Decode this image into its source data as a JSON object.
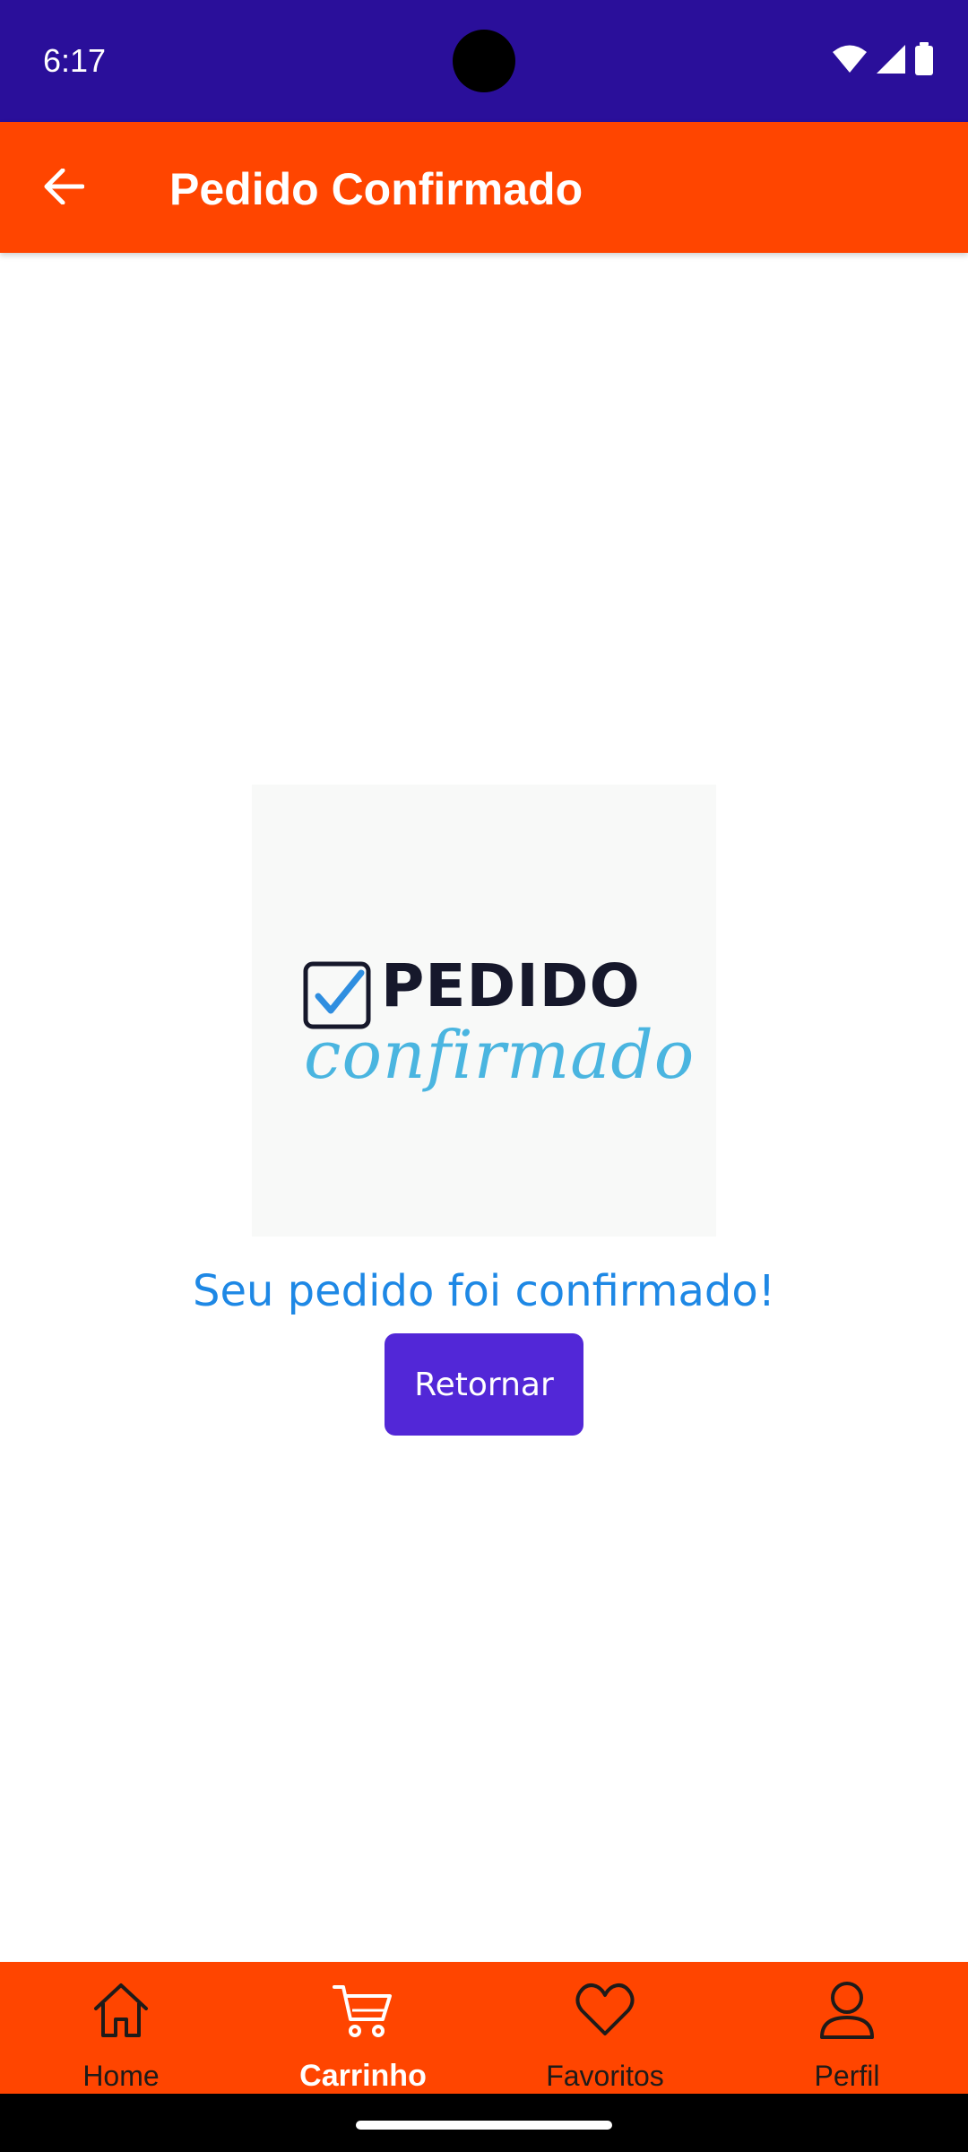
{
  "status_bar": {
    "time": "6:17"
  },
  "app_bar": {
    "title": "Pedido Confirmado",
    "back_icon": "arrow-back-icon"
  },
  "confirmation_image": {
    "title_word": "PEDIDO",
    "script_word": "confirmado",
    "check_icon": "checkbox-check-icon"
  },
  "message": "Seu pedido foi confirmado!",
  "return_button": {
    "label": "Retornar"
  },
  "bottom_nav": {
    "active": "Carrinho",
    "items": [
      {
        "label": "Home",
        "icon": "home-icon"
      },
      {
        "label": "Carrinho",
        "icon": "cart-icon"
      },
      {
        "label": "Favoritos",
        "icon": "heart-icon"
      },
      {
        "label": "Perfil",
        "icon": "person-icon"
      }
    ]
  },
  "colors": {
    "status_bar": "#2a0f9a",
    "app_bar": "#ff4500",
    "message_text": "#1e88e5",
    "button": "#5227d7",
    "nav_bar": "#ff4500"
  }
}
